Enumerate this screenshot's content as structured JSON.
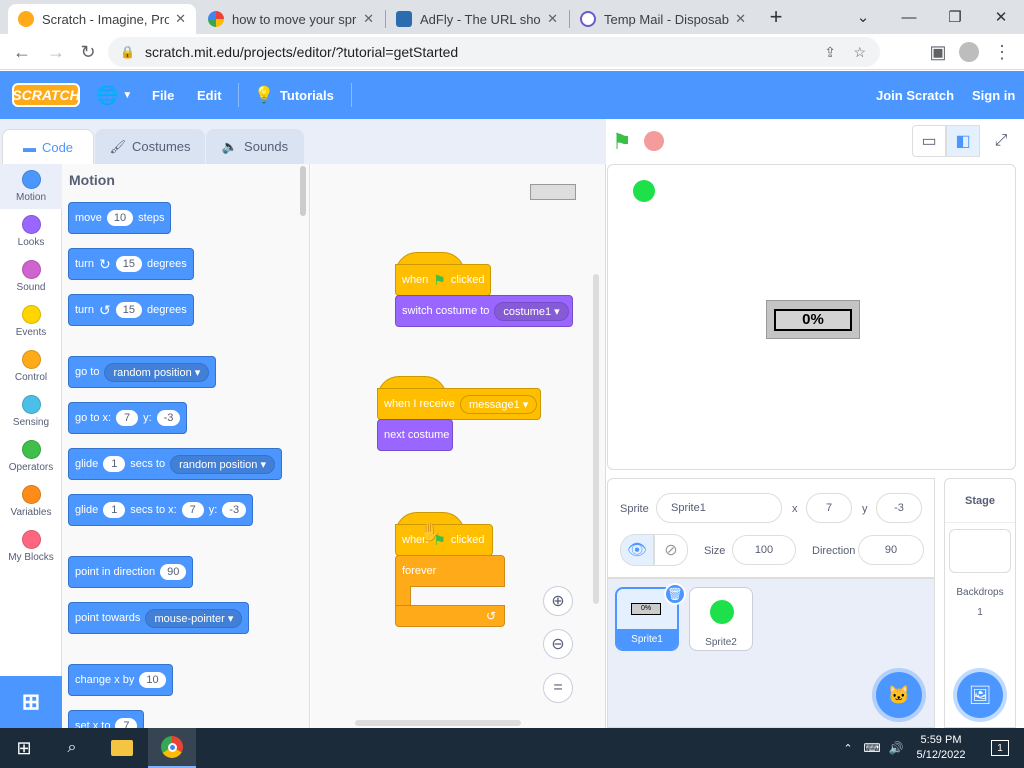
{
  "browser": {
    "tabs": [
      {
        "title": "Scratch - Imagine, Prog",
        "active": true,
        "favicon_color": "#ffab19"
      },
      {
        "title": "how to move your sprit",
        "active": false,
        "favicon_color": "#4285f4"
      },
      {
        "title": "AdFly - The URL shorte",
        "active": false,
        "favicon_color": "#2b6cb0"
      },
      {
        "title": "Temp Mail - Disposable",
        "active": false,
        "favicon_color": "#6a5acd"
      }
    ],
    "url": "scratch.mit.edu/projects/editor/?tutorial=getStarted"
  },
  "menubar": {
    "logo": "SCRATCH",
    "file": "File",
    "edit": "Edit",
    "tutorials": "Tutorials",
    "join": "Join Scratch",
    "signin": "Sign in"
  },
  "editor_tabs": {
    "code": "Code",
    "costumes": "Costumes",
    "sounds": "Sounds"
  },
  "categories": [
    {
      "label": "Motion",
      "color": "#4c97ff"
    },
    {
      "label": "Looks",
      "color": "#9966ff"
    },
    {
      "label": "Sound",
      "color": "#cf63cf"
    },
    {
      "label": "Events",
      "color": "#ffd500"
    },
    {
      "label": "Control",
      "color": "#ffab19"
    },
    {
      "label": "Sensing",
      "color": "#4cbfe6"
    },
    {
      "label": "Operators",
      "color": "#40bf4a"
    },
    {
      "label": "Variables",
      "color": "#ff8c1a"
    },
    {
      "label": "My Blocks",
      "color": "#ff6680"
    }
  ],
  "palette": {
    "title": "Motion",
    "move": {
      "t1": "move",
      "v": "10",
      "t2": "steps"
    },
    "turn_cw": {
      "t1": "turn",
      "v": "15",
      "t2": "degrees"
    },
    "turn_ccw": {
      "t1": "turn",
      "v": "15",
      "t2": "degrees"
    },
    "goto": {
      "t1": "go to",
      "d": "random position"
    },
    "goto_xy": {
      "t1": "go to x:",
      "x": "7",
      "t2": "y:",
      "y": "-3"
    },
    "glide": {
      "t1": "glide",
      "v": "1",
      "t2": "secs to",
      "d": "random position"
    },
    "glide_xy": {
      "t1": "glide",
      "v": "1",
      "t2": "secs to x:",
      "x": "7",
      "t3": "y:",
      "y": "-3"
    },
    "point_dir": {
      "t1": "point in direction",
      "v": "90"
    },
    "point_towards": {
      "t1": "point towards",
      "d": "mouse-pointer"
    },
    "change_x": {
      "t1": "change x by",
      "v": "10"
    },
    "set_x": {
      "t1": "set x to",
      "v": "7"
    }
  },
  "scripts": {
    "s1_hat": {
      "t1": "when",
      "t2": "clicked"
    },
    "s1_costume": {
      "t1": "switch costume to",
      "d": "costume1"
    },
    "s2_hat": {
      "t1": "when I receive",
      "d": "message1"
    },
    "s2_next": {
      "t1": "next costume"
    },
    "s3_hat": {
      "t1": "when",
      "t2": "clicked"
    },
    "s3_forever": {
      "t1": "forever"
    }
  },
  "stage": {
    "progress_text": "0%"
  },
  "sprite_info": {
    "sprite_label": "Sprite",
    "name": "Sprite1",
    "x_label": "x",
    "x": "7",
    "y_label": "y",
    "y": "-3",
    "size_label": "Size",
    "size": "100",
    "direction_label": "Direction",
    "direction": "90"
  },
  "sprites": [
    {
      "name": "Sprite1",
      "selected": true,
      "thumb_text": "0%"
    },
    {
      "name": "Sprite2",
      "selected": false
    }
  ],
  "stage_panel": {
    "title": "Stage",
    "backdrops_label": "Backdrops",
    "backdrops_count": "1"
  },
  "taskbar": {
    "time": "5:59 PM",
    "date": "5/12/2022",
    "notifications": "1"
  }
}
